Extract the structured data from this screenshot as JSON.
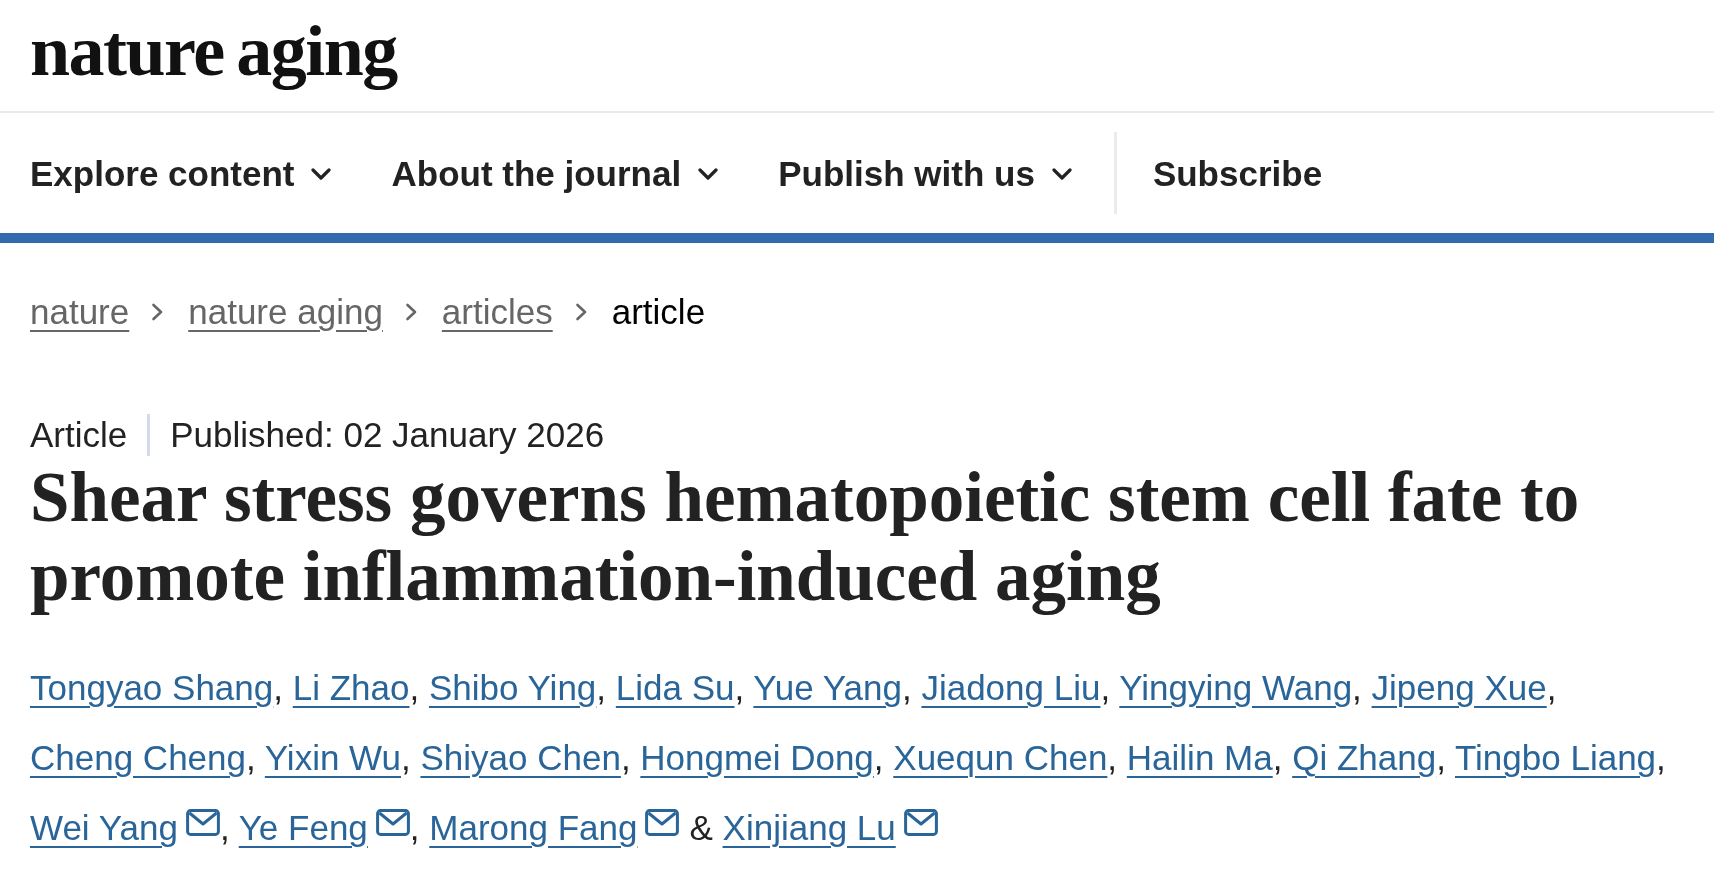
{
  "header": {
    "logo": "nature aging"
  },
  "nav": {
    "items": [
      {
        "label": "Explore content",
        "kind": "dropdown"
      },
      {
        "label": "About the journal",
        "kind": "dropdown"
      },
      {
        "label": "Publish with us",
        "kind": "dropdown"
      },
      {
        "label": "Subscribe",
        "kind": "link"
      }
    ]
  },
  "breadcrumbs": [
    {
      "label": "nature",
      "current": false
    },
    {
      "label": "nature aging",
      "current": false
    },
    {
      "label": "articles",
      "current": false
    },
    {
      "label": "article",
      "current": true
    }
  ],
  "article": {
    "type": "Article",
    "published": "Published: 02 January 2026",
    "title": "Shear stress governs hematopoietic stem cell fate to promote inflammation-induced aging",
    "authors": [
      {
        "name": "Tongyao Shang",
        "corresponding": false,
        "separator": {
          "kind": "comma",
          "text": ","
        }
      },
      {
        "name": "Li Zhao",
        "corresponding": false,
        "separator": {
          "kind": "comma",
          "text": ","
        }
      },
      {
        "name": "Shibo Ying",
        "corresponding": false,
        "separator": {
          "kind": "comma",
          "text": ","
        }
      },
      {
        "name": "Lida Su",
        "corresponding": false,
        "separator": {
          "kind": "comma",
          "text": ","
        }
      },
      {
        "name": "Yue Yang",
        "corresponding": false,
        "separator": {
          "kind": "comma",
          "text": ","
        }
      },
      {
        "name": "Jiadong Liu",
        "corresponding": false,
        "separator": {
          "kind": "comma",
          "text": ","
        }
      },
      {
        "name": "Yingying Wang",
        "corresponding": false,
        "separator": {
          "kind": "comma",
          "text": ","
        }
      },
      {
        "name": "Jipeng Xue",
        "corresponding": false,
        "separator": {
          "kind": "comma",
          "text": ","
        }
      },
      {
        "name": "Cheng Cheng",
        "corresponding": false,
        "separator": {
          "kind": "comma",
          "text": ","
        }
      },
      {
        "name": "Yixin Wu",
        "corresponding": false,
        "separator": {
          "kind": "comma",
          "text": ","
        }
      },
      {
        "name": "Shiyao Chen",
        "corresponding": false,
        "separator": {
          "kind": "comma",
          "text": ","
        }
      },
      {
        "name": "Hongmei Dong",
        "corresponding": false,
        "separator": {
          "kind": "comma",
          "text": ","
        }
      },
      {
        "name": "Xuequn Chen",
        "corresponding": false,
        "separator": {
          "kind": "comma",
          "text": ","
        }
      },
      {
        "name": "Hailin Ma",
        "corresponding": false,
        "separator": {
          "kind": "comma",
          "text": ","
        }
      },
      {
        "name": "Qi Zhang",
        "corresponding": false,
        "separator": {
          "kind": "comma",
          "text": ","
        }
      },
      {
        "name": "Tingbo Liang",
        "corresponding": false,
        "separator": {
          "kind": "comma",
          "text": ","
        }
      },
      {
        "name": "Wei Yang",
        "corresponding": true,
        "separator": {
          "kind": "comma",
          "text": ","
        }
      },
      {
        "name": "Ye Feng",
        "corresponding": true,
        "separator": {
          "kind": "comma",
          "text": ","
        }
      },
      {
        "name": "Marong Fang",
        "corresponding": true,
        "separator": {
          "kind": "conjunction",
          "text": "&"
        }
      },
      {
        "name": "Xinjiang Lu",
        "corresponding": true
      }
    ]
  }
}
